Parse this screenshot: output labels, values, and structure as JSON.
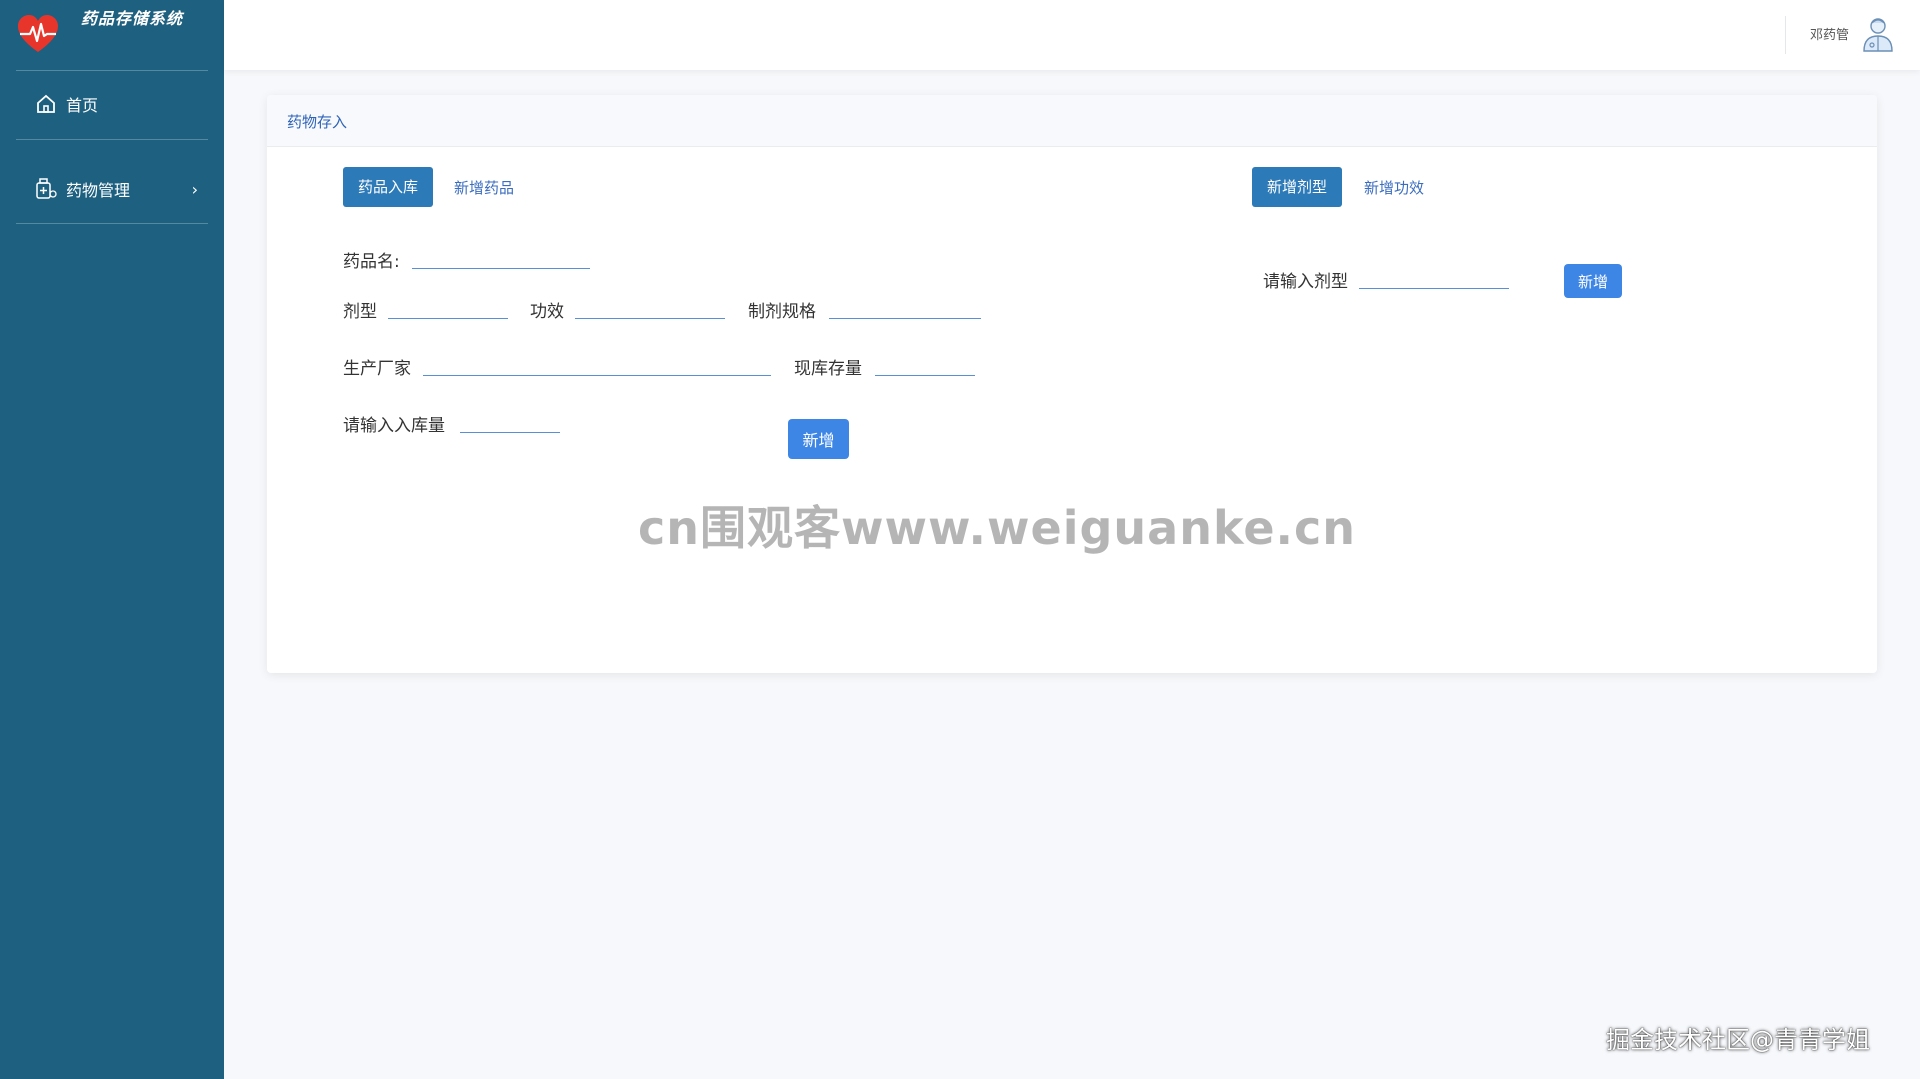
{
  "app": {
    "title": "药品存储系统"
  },
  "sidebar": {
    "items": [
      {
        "label": "首页",
        "icon": "home-icon"
      },
      {
        "label": "药物管理",
        "icon": "medicine-kit-icon",
        "chevron": "›"
      }
    ]
  },
  "header": {
    "user_name": "邓药管",
    "avatar_icon": "doctor-avatar-icon"
  },
  "card": {
    "title": "药物存入",
    "left_tabs": {
      "active": "药品入库",
      "other": "新增药品"
    },
    "right_tabs": {
      "active": "新增剂型",
      "other": "新增功效"
    },
    "form": {
      "drug_name_label": "药品名:",
      "dosage_form_label": "剂型",
      "efficacy_label": "功效",
      "spec_label": "制剂规格",
      "manufacturer_label": "生产厂家",
      "current_stock_label": "现库存量",
      "inbound_qty_label": "请输入入库量",
      "submit_label": "新增"
    },
    "dosage_form_add": {
      "label": "请输入剂型",
      "submit_label": "新增"
    }
  },
  "watermarks": {
    "center": "cn围观客www.weiguanke.cn",
    "corner": "掘金技术社区@青青学姐"
  },
  "colors": {
    "sidebar_bg": "#1e6080",
    "primary": "#3d86e6",
    "tab_active": "#2d7ab8",
    "link": "#3b6cbf"
  }
}
